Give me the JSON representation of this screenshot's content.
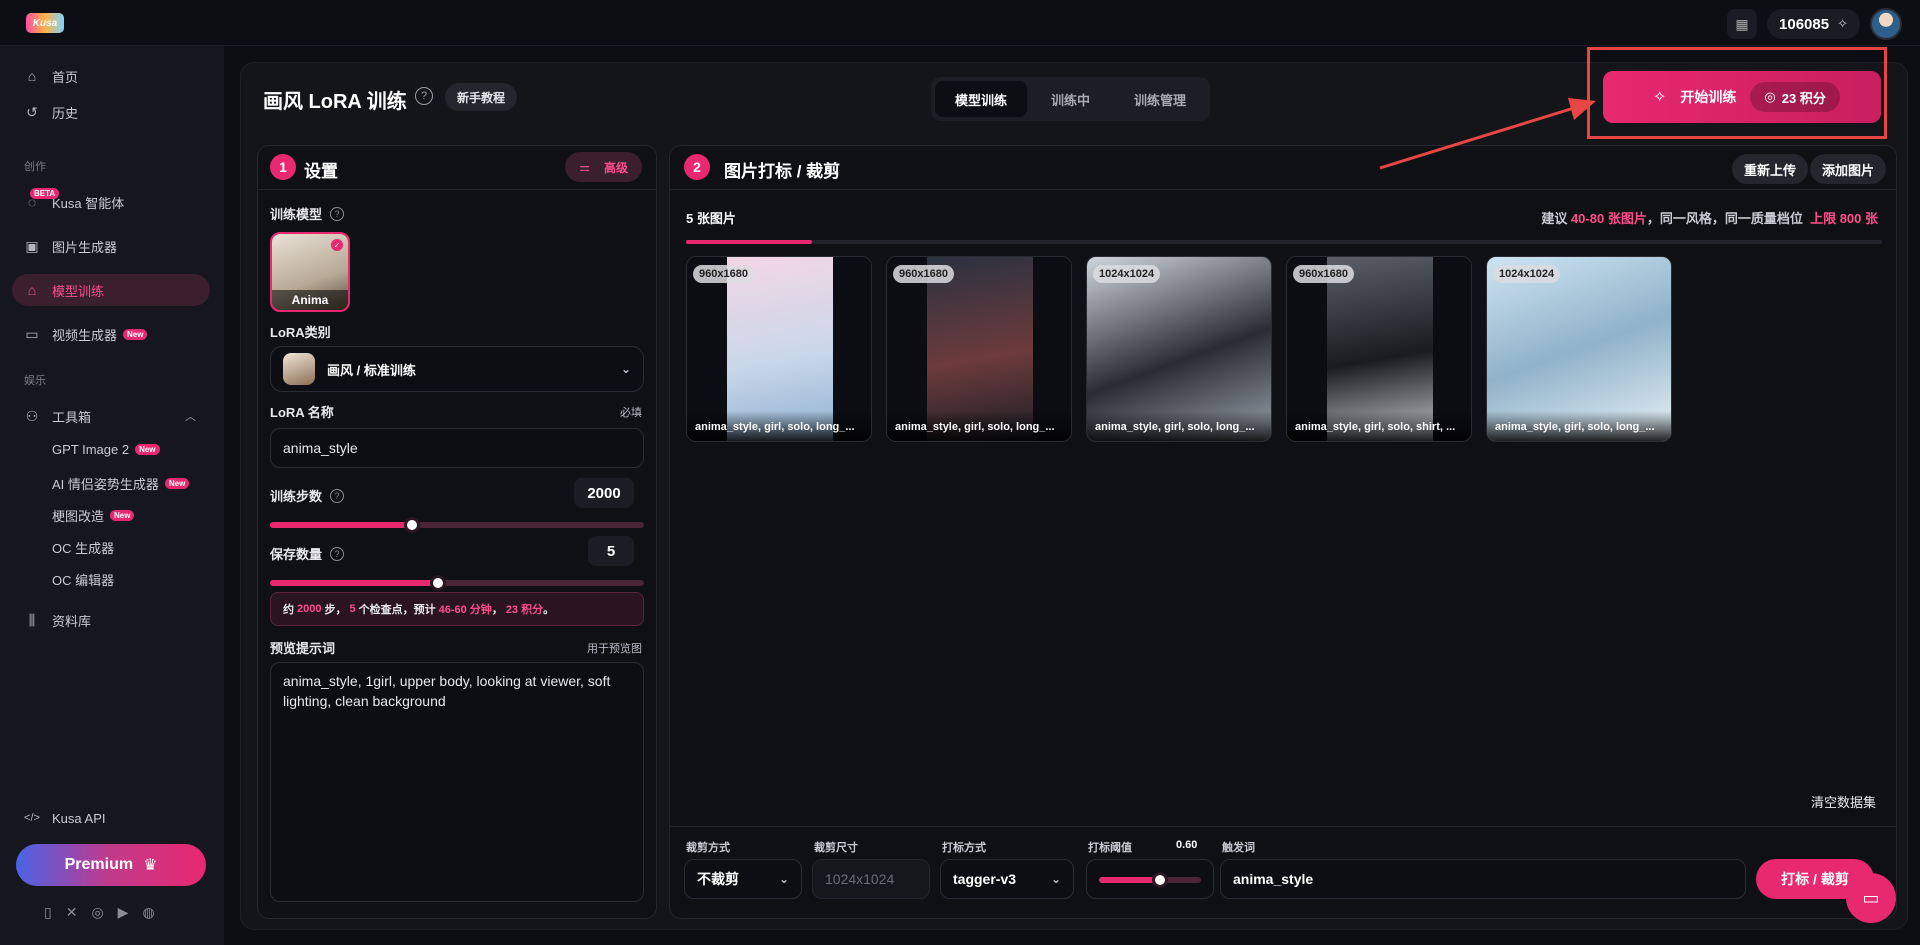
{
  "app": {
    "logo_text": "Kusa"
  },
  "topbar": {
    "credits": "106085"
  },
  "sidebar": {
    "items": [
      {
        "label": "首页"
      },
      {
        "label": "历史"
      },
      {
        "label": "Kusa 智能体",
        "badge": "BETA"
      },
      {
        "label": "图片生成器"
      },
      {
        "label": "模型训练"
      },
      {
        "label": "视频生成器",
        "badge": "New"
      },
      {
        "label": "工具箱"
      },
      {
        "label": "资料库"
      }
    ],
    "section_create": "创作",
    "section_fun": "娱乐",
    "tools": [
      {
        "label": "GPT Image 2",
        "badge": "New"
      },
      {
        "label": "AI 情侣姿势生成器",
        "badge": "New"
      },
      {
        "label": "梗图改造",
        "badge": "New"
      },
      {
        "label": "OC 生成器"
      },
      {
        "label": "OC 编辑器"
      }
    ],
    "api_label": "Kusa API",
    "premium_label": "Premium"
  },
  "header": {
    "title": "画风 LoRA 训练",
    "tutorial": "新手教程",
    "tabs": [
      {
        "label": "模型训练"
      },
      {
        "label": "训练中"
      },
      {
        "label": "训练管理"
      }
    ],
    "start_label": "开始训练",
    "cost_label": "23 积分"
  },
  "settings": {
    "step": "1",
    "title": "设置",
    "advanced": "高级",
    "model_label": "训练模型",
    "model_name": "Anima",
    "lora_type_label": "LoRA类别",
    "lora_type_value": "画风 / 标准训练",
    "lora_name_label": "LoRA 名称",
    "required": "必填",
    "lora_name_value": "anima_style",
    "steps_label": "训练步数",
    "steps_value": "2000",
    "steps_fraction": 0.38,
    "save_label": "保存数量",
    "save_value": "5",
    "save_fraction": 0.45,
    "est_prefix": "约",
    "est_steps": "2000",
    "est_t1": "步，",
    "est_ckpt": "5",
    "est_t2": "个检查点，预计",
    "est_time": "46-60 分钟",
    "est_t3": "，",
    "est_cost": "23 积分",
    "est_t4": "。",
    "preview_label": "预览提示词",
    "preview_note": "用于预览图",
    "preview_text": "anima_style, 1girl, upper body, looking at viewer, soft lighting, clean background"
  },
  "dataset": {
    "step": "2",
    "title": "图片打标 / 裁剪",
    "reupload": "重新上传",
    "add_images": "添加图片",
    "count": "5 张图片",
    "suggest_prefix": "建议",
    "suggest_range": "40-80 张图片",
    "suggest_mid": "，同一风格，同一质量档位",
    "suggest_limit": "上限 800 张",
    "progress_fraction": 0.105,
    "images": [
      {
        "res": "960x1680",
        "caption": "anima_style, girl, solo, long_..."
      },
      {
        "res": "960x1680",
        "caption": "anima_style, girl, solo, long_..."
      },
      {
        "res": "1024x1024",
        "caption": "anima_style, girl, solo, long_..."
      },
      {
        "res": "960x1680",
        "caption": "anima_style, girl, solo, shirt, ..."
      },
      {
        "res": "1024x1024",
        "caption": "anima_style, girl, solo, long_..."
      }
    ],
    "clear": "清空数据集",
    "crop_mode_label": "裁剪方式",
    "crop_mode_value": "不裁剪",
    "crop_size_label": "裁剪尺寸",
    "crop_size_value": "1024x1024",
    "tag_mode_label": "打标方式",
    "tag_mode_value": "tagger-v3",
    "threshold_label": "打标阈值",
    "threshold_value": "0.60",
    "threshold_fraction": 0.6,
    "trigger_label": "触发词",
    "trigger_value": "anima_style",
    "tag_button": "打标 / 裁剪"
  },
  "colors": {
    "accent": "#e8286f",
    "bg": "#0d0e13"
  }
}
